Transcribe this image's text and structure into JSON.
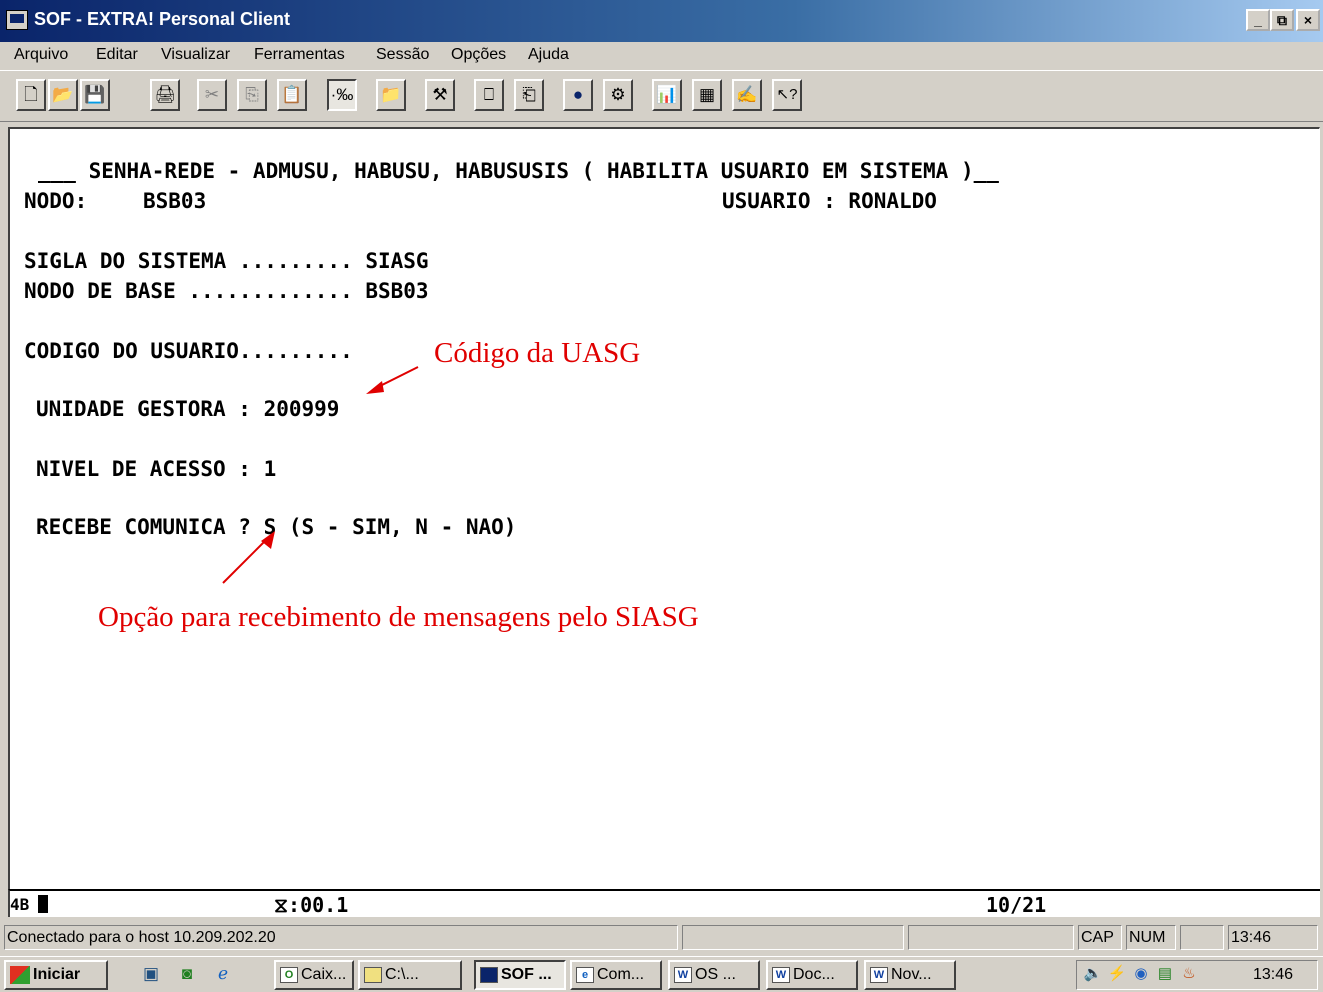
{
  "window": {
    "title": "SOF - EXTRA! Personal Client",
    "controls": {
      "minimize": "_",
      "restore": "Ɛ",
      "close": "×"
    }
  },
  "menu": [
    "Arquivo",
    "Editar",
    "Visualizar",
    "Ferramentas",
    "Sessão",
    "Opções",
    "Ajuda"
  ],
  "toolbar": [
    {
      "icon": "new-icon",
      "glyph": "🗋"
    },
    {
      "icon": "open-icon",
      "glyph": "📂"
    },
    {
      "icon": "save-icon",
      "glyph": "💾"
    },
    {
      "icon": "print-icon",
      "glyph": "🖨"
    },
    {
      "icon": "cut-icon",
      "glyph": "✂"
    },
    {
      "icon": "copy-icon",
      "glyph": "⎘"
    },
    {
      "icon": "paste-icon",
      "glyph": "📋"
    },
    {
      "icon": "record-icon",
      "glyph": "·‰"
    },
    {
      "icon": "folder-up-icon",
      "glyph": "📁"
    },
    {
      "icon": "tools-icon",
      "glyph": "⚒"
    },
    {
      "icon": "transfer-icon",
      "glyph": "⎕"
    },
    {
      "icon": "receive-icon",
      "glyph": "⎗"
    },
    {
      "icon": "dot-icon",
      "glyph": "●"
    },
    {
      "icon": "macro-icon",
      "glyph": "⚙"
    },
    {
      "icon": "chart-edit-icon",
      "glyph": "📊"
    },
    {
      "icon": "grid-icon",
      "glyph": "▦"
    },
    {
      "icon": "signature-icon",
      "glyph": "✍"
    },
    {
      "icon": "help-icon",
      "glyph": "↖?"
    }
  ],
  "terminal": {
    "lines": [
      "___ SENHA-REDE - ADMUSU, HABUSU, HABUSUSIS ( HABILITA USUARIO EM SISTEMA )__",
      "NODO:",
      "BSB03",
      "USUARIO : RONALDO",
      "SIGLA DO SISTEMA ......... SIASG",
      "NODO DE BASE ............. BSB03",
      "CODIGO DO USUARIO.........",
      "UNIDADE GESTORA : 200999",
      "NIVEL DE ACESSO : 1",
      "RECEBE COMUNICA ? S (S - SIM, N - NAO)"
    ]
  },
  "annotations": {
    "uasg": "Código da UASG",
    "mensagens": "Opção para recebimento de mensagens pelo SIASG"
  },
  "oia": {
    "indicator": "4B",
    "clock": "⧖:00.1",
    "position": "10/21"
  },
  "status": {
    "message": "Conectado para o host 10.209.202.20",
    "cap": "CAP",
    "num": "NUM",
    "time": "13:46"
  },
  "taskbar": {
    "start": "Iniciar",
    "buttons": [
      "Caix...",
      "C:\\...",
      "SOF ...",
      "Com...",
      "OS ...",
      "Doc...",
      "Nov..."
    ],
    "clock": "13:46"
  },
  "colors": {
    "annotation": "#e00000",
    "titlebar": "#0a246a",
    "desktop": "#d4d0c8"
  }
}
